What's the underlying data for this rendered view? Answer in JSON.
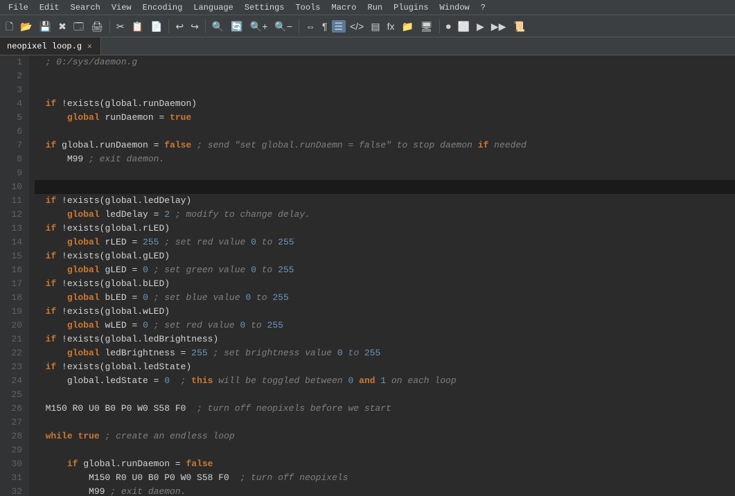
{
  "menubar": {
    "items": [
      "File",
      "Edit",
      "Search",
      "View",
      "Encoding",
      "Language",
      "Settings",
      "Tools",
      "Macro",
      "Run",
      "Plugins",
      "Window",
      "?"
    ]
  },
  "toolbar": {
    "buttons": [
      "🗋",
      "🗁",
      "💾",
      "✖",
      "🗔",
      "🖨",
      "✂",
      "📋",
      "📄",
      "↩",
      "↪",
      "🔍",
      "🔄",
      "🔍+",
      "🔍-",
      "⬛",
      "⬛",
      "↔",
      "¶",
      "▶",
      "</>",
      "▤",
      "fx",
      "⬛",
      "▣",
      "⏺",
      "⬜",
      "⬜",
      "▶▶"
    ]
  },
  "tabs": [
    {
      "label": "neopixel loop.g",
      "active": true
    }
  ],
  "lines": [
    {
      "num": 1,
      "content": "  ; 0:/sys/daemon.g"
    },
    {
      "num": 2,
      "content": ""
    },
    {
      "num": 3,
      "content": ""
    },
    {
      "num": 4,
      "content": "  if !exists(global.runDaemon)"
    },
    {
      "num": 5,
      "content": "      global runDaemon = true"
    },
    {
      "num": 6,
      "content": ""
    },
    {
      "num": 7,
      "content": "  if global.runDaemon = false ; send \"set global.runDaemn = false\" to stop daemon if needed"
    },
    {
      "num": 8,
      "content": "      M99 ; exit daemon."
    },
    {
      "num": 9,
      "content": ""
    },
    {
      "num": 10,
      "content": ""
    },
    {
      "num": 11,
      "content": "  if !exists(global.ledDelay)"
    },
    {
      "num": 12,
      "content": "      global ledDelay = 2 ; modify to change delay."
    },
    {
      "num": 13,
      "content": "  if !exists(global.rLED)"
    },
    {
      "num": 14,
      "content": "      global rLED = 255 ; set red value 0 to 255"
    },
    {
      "num": 15,
      "content": "  if !exists(global.gLED)"
    },
    {
      "num": 16,
      "content": "      global gLED = 0 ; set green value 0 to 255"
    },
    {
      "num": 17,
      "content": "  if !exists(global.bLED)"
    },
    {
      "num": 18,
      "content": "      global bLED = 0 ; set blue value 0 to 255"
    },
    {
      "num": 19,
      "content": "  if !exists(global.wLED)"
    },
    {
      "num": 20,
      "content": "      global wLED = 0 ; set red value 0 to 255"
    },
    {
      "num": 21,
      "content": "  if !exists(global.ledBrightness)"
    },
    {
      "num": 22,
      "content": "      global ledBrightness = 255 ; set brightness value 0 to 255"
    },
    {
      "num": 23,
      "content": "  if !exists(global.ledState)"
    },
    {
      "num": 24,
      "content": "      global.ledState = 0  ; this will be toggled between 0 and 1 on each loop"
    },
    {
      "num": 25,
      "content": ""
    },
    {
      "num": 26,
      "content": "  M150 R0 U0 B0 P0 W0 S58 F0  ; turn off neopixels before we start"
    },
    {
      "num": 27,
      "content": ""
    },
    {
      "num": 28,
      "content": "  while true ; create an endless loop"
    },
    {
      "num": 29,
      "content": ""
    },
    {
      "num": 30,
      "content": "      if global.runDaemon = false"
    },
    {
      "num": 31,
      "content": "          M150 R0 U0 B0 P0 W0 S58 F0  ; turn off neopixels"
    },
    {
      "num": 32,
      "content": "          M99 ; exit daemon."
    }
  ]
}
